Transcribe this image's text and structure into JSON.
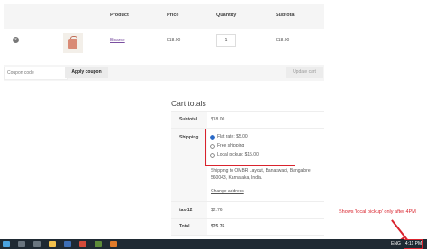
{
  "cart": {
    "headers": {
      "product": "Product",
      "price": "Price",
      "quantity": "Quantity",
      "subtotal": "Subtotal"
    },
    "item": {
      "remove": "×",
      "name": "Bicarse",
      "price": "$18.00",
      "quantity": "1",
      "subtotal": "$18.00"
    },
    "coupon_placeholder": "Coupon code",
    "apply_label": "Apply coupon",
    "update_label": "Update cart"
  },
  "totals": {
    "title": "Cart totals",
    "subtotal_label": "Subtotal",
    "subtotal_value": "$18.00",
    "shipping_label": "Shipping",
    "options": [
      {
        "label": "Flat rate: $5.00",
        "selected": true
      },
      {
        "label": "Free shipping",
        "selected": false
      },
      {
        "label": "Local pickup: $15.00",
        "selected": false
      }
    ],
    "shipping_to": "Shipping to OMBR Layout, Banaswadi, Bangalore 560043, Karnataka, India.",
    "change_address": "Change address",
    "tax_label": "tax-12",
    "tax_value": "$2.76",
    "total_label": "Total",
    "total_value": "$25.76"
  },
  "annotation": {
    "note": "Shows 'local pickup' only after 4PM",
    "color": "#d9232d"
  },
  "taskbar": {
    "lang": "ENG",
    "clock": "4:11 PM"
  }
}
